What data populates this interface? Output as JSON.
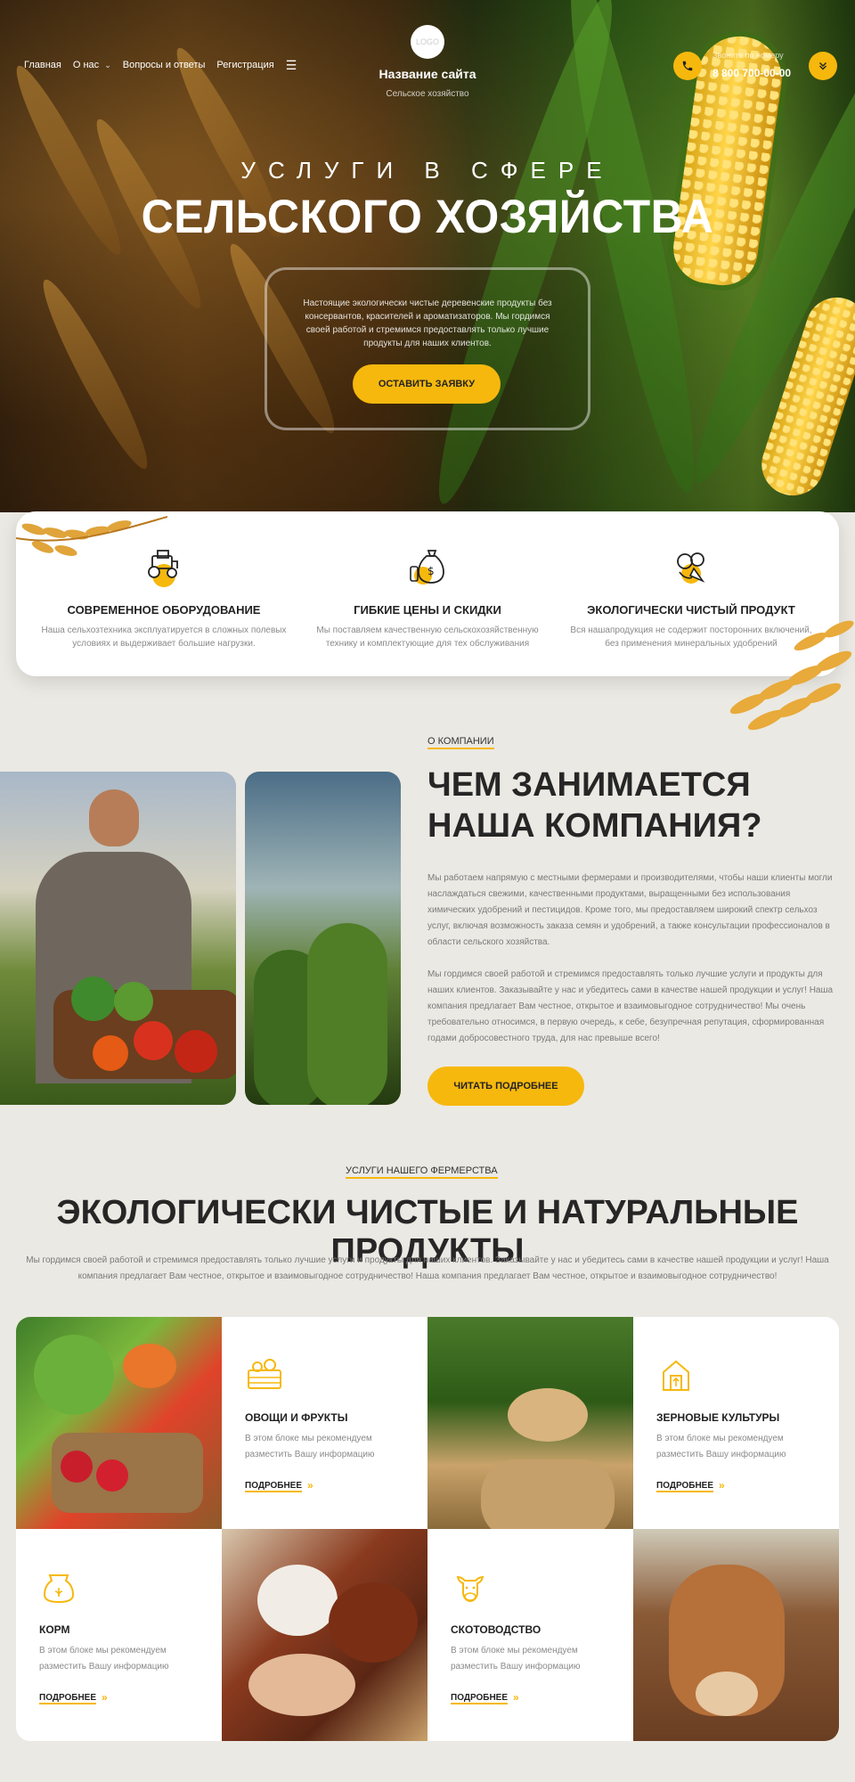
{
  "colors": {
    "accent": "#f6b80d",
    "text": "#262626",
    "muted": "#7a7a7a",
    "background": "#ebe9e3"
  },
  "header": {
    "nav": [
      "Главная",
      "О нас",
      "Вопросы и ответы",
      "Регистрация"
    ],
    "logo_text": "LOGO",
    "site_title": "Название сайта",
    "site_subtitle": "Сельское хозяйство",
    "phone_caption": "Звоните по номеру",
    "phone_number": "8 800 700-00-00"
  },
  "hero": {
    "kicker": "УСЛУГИ В СФЕРЕ",
    "title": "СЕЛЬСКОГО ХОЗЯЙСТВА",
    "text": "Настоящие экологически чистые деревенские продукты без консервантов, красителей и ароматизаторов. Мы гордимся своей работой и стремимся предоставлять только лучшие продукты для наших клиентов.",
    "cta": "ОСТАВИТЬ ЗАЯВКУ"
  },
  "features": [
    {
      "title": "СОВРЕМЕННОЕ ОБОРУДОВАНИЕ",
      "text": "Наша сельхозтехника эксплуатируется в сложных полевых условиях и выдерживает большие нагрузки.",
      "icon": "tractor-icon"
    },
    {
      "title": "ГИБКИЕ ЦЕНЫ И СКИДКИ",
      "text": "Мы поставляем качественную сельскохозяйственную технику и комплектующие для тех обслуживания",
      "icon": "money-bag-icon"
    },
    {
      "title": "ЭКОЛОГИЧЕСКИ ЧИСТЫЙ ПРОДУКТ",
      "text": "Вся нашапродукция не содержит посторонних включений, без применения минеральных удобрений",
      "icon": "vegetables-icon"
    }
  ],
  "about": {
    "eyebrow": "О КОМПАНИИ",
    "title": "ЧЕМ ЗАНИМАЕТСЯ НАША КОМПАНИЯ?",
    "p1": "Мы работаем напрямую с местными фермерами и производителями, чтобы наши клиенты могли наслаждаться свежими, качественными продуктами, выращенными без использования химических удобрений и пестицидов. Кроме того, мы предоставляем широкий спектр сельхоз услуг, включая возможность заказа семян и удобрений, а также консультации профессионалов в области сельского хозяйства.",
    "p2": "Мы гордимся своей работой и стремимся предоставлять только лучшие услуги и продукты для наших клиентов. Заказывайте у нас и убедитесь сами в качестве нашей продукции и услуг! Наша компания предлагает Вам честное, открытое и взаимовыгодное сотрудничество! Мы очень требовательно относимся, в первую очередь, к себе, безупречная репутация, сформированная годами добросовестного труда, для нас превыше всего!",
    "button": "ЧИТАТЬ ПОДРОБНЕЕ"
  },
  "services": {
    "eyebrow": "УСЛУГИ НАШЕГО ФЕРМЕРСТВА",
    "title": "ЭКОЛОГИЧЕСКИ ЧИСТЫЕ И НАТУРАЛЬНЫЕ ПРОДУКТЫ",
    "text": "Мы гордимся своей работой и стремимся предоставлять только лучшие услуги и продукты для наших клиентов. Заказывайте у нас и убедитесь сами в качестве нашей продукции и услуг! Наша компания предлагает Вам честное, открытое и взаимовыгодное сотрудничество! Наша компания предлагает Вам честное, открытое и взаимовыгодное сотрудничество!",
    "cards": [
      {
        "title": "ОВОЩИ И ФРУКТЫ",
        "text": "В этом блоке мы рекомендуем разместить Вашу информацию",
        "more": "ПОДРОБНЕЕ",
        "icon": "vegetable-crate-icon"
      },
      {
        "title": "ЗЕРНОВЫЕ КУЛЬТУРЫ",
        "text": "В этом блоке мы рекомендуем разместить Вашу информацию",
        "more": "ПОДРОБНЕЕ",
        "icon": "grain-silo-icon"
      },
      {
        "title": "КОРМ",
        "text": "В этом блоке мы рекомендуем разместить Вашу информацию",
        "more": "ПОДРОБНЕЕ",
        "icon": "feed-sack-icon"
      },
      {
        "title": "СКОТОВОДСТВО",
        "text": "В этом блоке мы рекомендуем разместить Вашу информацию",
        "more": "ПОДРОБНЕЕ",
        "icon": "cow-icon"
      }
    ]
  }
}
